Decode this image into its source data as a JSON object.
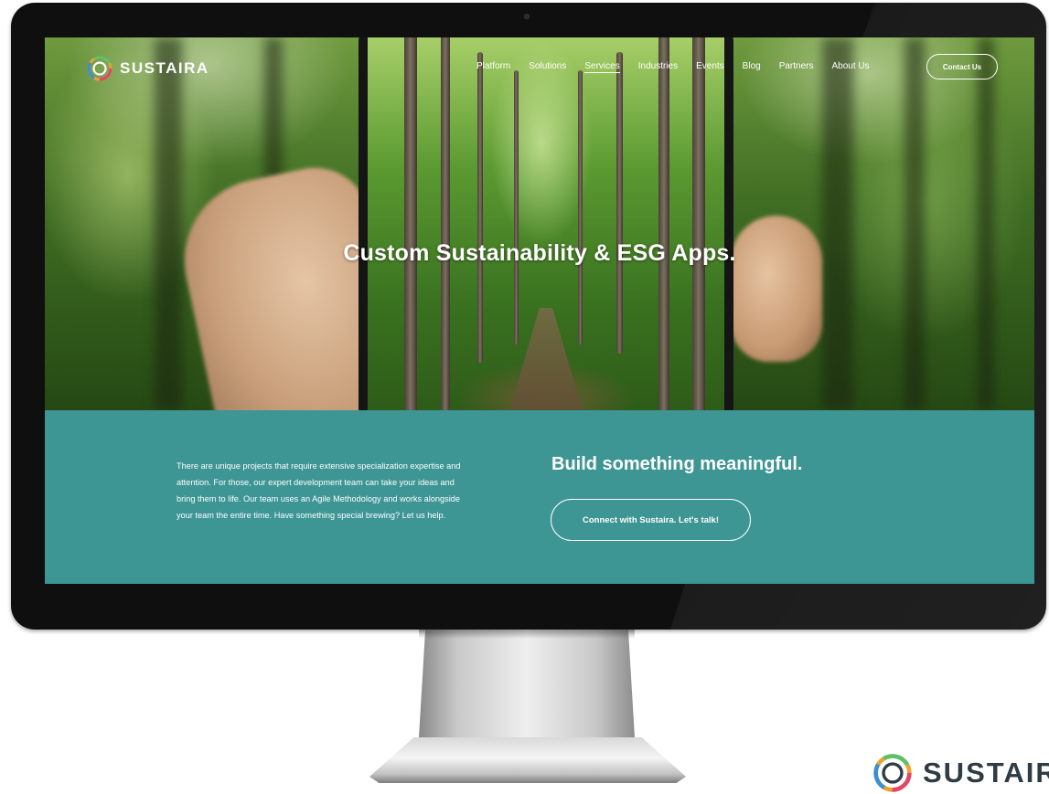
{
  "brand": {
    "name": "SUSTAIRA"
  },
  "nav": {
    "items": [
      {
        "label": "Platform",
        "active": false
      },
      {
        "label": "Solutions",
        "active": false
      },
      {
        "label": "Services",
        "active": true
      },
      {
        "label": "Industries",
        "active": false
      },
      {
        "label": "Events",
        "active": false
      },
      {
        "label": "Blog",
        "active": false
      },
      {
        "label": "Partners",
        "active": false
      },
      {
        "label": "About Us",
        "active": false
      }
    ],
    "contact_label": "Contact Us"
  },
  "hero": {
    "title": "Custom Sustainability & ESG Apps."
  },
  "intro": {
    "text": "There are unique projects that require extensive specialization expertise and attention. For those, our expert development team can take your ideas and bring them to life. Our team uses an Agile Methodology and works alongside your team the entire time. Have something special brewing? Let us help."
  },
  "cta": {
    "title": "Build something meaningful.",
    "button_label": "Connect with Sustaira. Let's talk!"
  },
  "corner_logo": {
    "text": "SUSTAIR"
  },
  "colors": {
    "teal": "#3d9594",
    "bezel": "#0f0f0f",
    "text_light": "#ffffff",
    "logo_dark": "#2f3c45"
  }
}
